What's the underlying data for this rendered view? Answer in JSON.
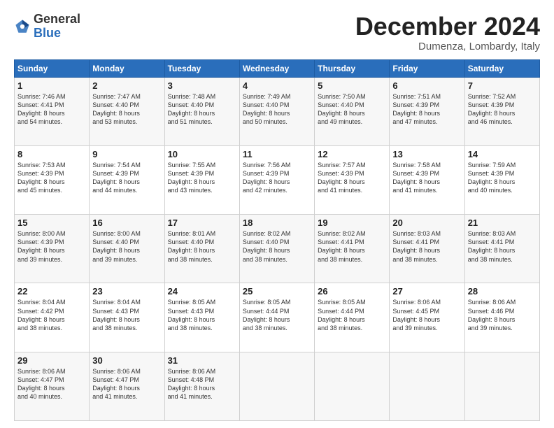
{
  "header": {
    "logo_general": "General",
    "logo_blue": "Blue",
    "month_year": "December 2024",
    "location": "Dumenza, Lombardy, Italy"
  },
  "days_of_week": [
    "Sunday",
    "Monday",
    "Tuesday",
    "Wednesday",
    "Thursday",
    "Friday",
    "Saturday"
  ],
  "weeks": [
    [
      {
        "day": "1",
        "lines": [
          "Sunrise: 7:46 AM",
          "Sunset: 4:41 PM",
          "Daylight: 8 hours",
          "and 54 minutes."
        ]
      },
      {
        "day": "2",
        "lines": [
          "Sunrise: 7:47 AM",
          "Sunset: 4:40 PM",
          "Daylight: 8 hours",
          "and 53 minutes."
        ]
      },
      {
        "day": "3",
        "lines": [
          "Sunrise: 7:48 AM",
          "Sunset: 4:40 PM",
          "Daylight: 8 hours",
          "and 51 minutes."
        ]
      },
      {
        "day": "4",
        "lines": [
          "Sunrise: 7:49 AM",
          "Sunset: 4:40 PM",
          "Daylight: 8 hours",
          "and 50 minutes."
        ]
      },
      {
        "day": "5",
        "lines": [
          "Sunrise: 7:50 AM",
          "Sunset: 4:40 PM",
          "Daylight: 8 hours",
          "and 49 minutes."
        ]
      },
      {
        "day": "6",
        "lines": [
          "Sunrise: 7:51 AM",
          "Sunset: 4:39 PM",
          "Daylight: 8 hours",
          "and 47 minutes."
        ]
      },
      {
        "day": "7",
        "lines": [
          "Sunrise: 7:52 AM",
          "Sunset: 4:39 PM",
          "Daylight: 8 hours",
          "and 46 minutes."
        ]
      }
    ],
    [
      {
        "day": "8",
        "lines": [
          "Sunrise: 7:53 AM",
          "Sunset: 4:39 PM",
          "Daylight: 8 hours",
          "and 45 minutes."
        ]
      },
      {
        "day": "9",
        "lines": [
          "Sunrise: 7:54 AM",
          "Sunset: 4:39 PM",
          "Daylight: 8 hours",
          "and 44 minutes."
        ]
      },
      {
        "day": "10",
        "lines": [
          "Sunrise: 7:55 AM",
          "Sunset: 4:39 PM",
          "Daylight: 8 hours",
          "and 43 minutes."
        ]
      },
      {
        "day": "11",
        "lines": [
          "Sunrise: 7:56 AM",
          "Sunset: 4:39 PM",
          "Daylight: 8 hours",
          "and 42 minutes."
        ]
      },
      {
        "day": "12",
        "lines": [
          "Sunrise: 7:57 AM",
          "Sunset: 4:39 PM",
          "Daylight: 8 hours",
          "and 41 minutes."
        ]
      },
      {
        "day": "13",
        "lines": [
          "Sunrise: 7:58 AM",
          "Sunset: 4:39 PM",
          "Daylight: 8 hours",
          "and 41 minutes."
        ]
      },
      {
        "day": "14",
        "lines": [
          "Sunrise: 7:59 AM",
          "Sunset: 4:39 PM",
          "Daylight: 8 hours",
          "and 40 minutes."
        ]
      }
    ],
    [
      {
        "day": "15",
        "lines": [
          "Sunrise: 8:00 AM",
          "Sunset: 4:39 PM",
          "Daylight: 8 hours",
          "and 39 minutes."
        ]
      },
      {
        "day": "16",
        "lines": [
          "Sunrise: 8:00 AM",
          "Sunset: 4:40 PM",
          "Daylight: 8 hours",
          "and 39 minutes."
        ]
      },
      {
        "day": "17",
        "lines": [
          "Sunrise: 8:01 AM",
          "Sunset: 4:40 PM",
          "Daylight: 8 hours",
          "and 38 minutes."
        ]
      },
      {
        "day": "18",
        "lines": [
          "Sunrise: 8:02 AM",
          "Sunset: 4:40 PM",
          "Daylight: 8 hours",
          "and 38 minutes."
        ]
      },
      {
        "day": "19",
        "lines": [
          "Sunrise: 8:02 AM",
          "Sunset: 4:41 PM",
          "Daylight: 8 hours",
          "and 38 minutes."
        ]
      },
      {
        "day": "20",
        "lines": [
          "Sunrise: 8:03 AM",
          "Sunset: 4:41 PM",
          "Daylight: 8 hours",
          "and 38 minutes."
        ]
      },
      {
        "day": "21",
        "lines": [
          "Sunrise: 8:03 AM",
          "Sunset: 4:41 PM",
          "Daylight: 8 hours",
          "and 38 minutes."
        ]
      }
    ],
    [
      {
        "day": "22",
        "lines": [
          "Sunrise: 8:04 AM",
          "Sunset: 4:42 PM",
          "Daylight: 8 hours",
          "and 38 minutes."
        ]
      },
      {
        "day": "23",
        "lines": [
          "Sunrise: 8:04 AM",
          "Sunset: 4:43 PM",
          "Daylight: 8 hours",
          "and 38 minutes."
        ]
      },
      {
        "day": "24",
        "lines": [
          "Sunrise: 8:05 AM",
          "Sunset: 4:43 PM",
          "Daylight: 8 hours",
          "and 38 minutes."
        ]
      },
      {
        "day": "25",
        "lines": [
          "Sunrise: 8:05 AM",
          "Sunset: 4:44 PM",
          "Daylight: 8 hours",
          "and 38 minutes."
        ]
      },
      {
        "day": "26",
        "lines": [
          "Sunrise: 8:05 AM",
          "Sunset: 4:44 PM",
          "Daylight: 8 hours",
          "and 38 minutes."
        ]
      },
      {
        "day": "27",
        "lines": [
          "Sunrise: 8:06 AM",
          "Sunset: 4:45 PM",
          "Daylight: 8 hours",
          "and 39 minutes."
        ]
      },
      {
        "day": "28",
        "lines": [
          "Sunrise: 8:06 AM",
          "Sunset: 4:46 PM",
          "Daylight: 8 hours",
          "and 39 minutes."
        ]
      }
    ],
    [
      {
        "day": "29",
        "lines": [
          "Sunrise: 8:06 AM",
          "Sunset: 4:47 PM",
          "Daylight: 8 hours",
          "and 40 minutes."
        ]
      },
      {
        "day": "30",
        "lines": [
          "Sunrise: 8:06 AM",
          "Sunset: 4:47 PM",
          "Daylight: 8 hours",
          "and 41 minutes."
        ]
      },
      {
        "day": "31",
        "lines": [
          "Sunrise: 8:06 AM",
          "Sunset: 4:48 PM",
          "Daylight: 8 hours",
          "and 41 minutes."
        ]
      },
      {
        "day": "",
        "lines": []
      },
      {
        "day": "",
        "lines": []
      },
      {
        "day": "",
        "lines": []
      },
      {
        "day": "",
        "lines": []
      }
    ]
  ]
}
